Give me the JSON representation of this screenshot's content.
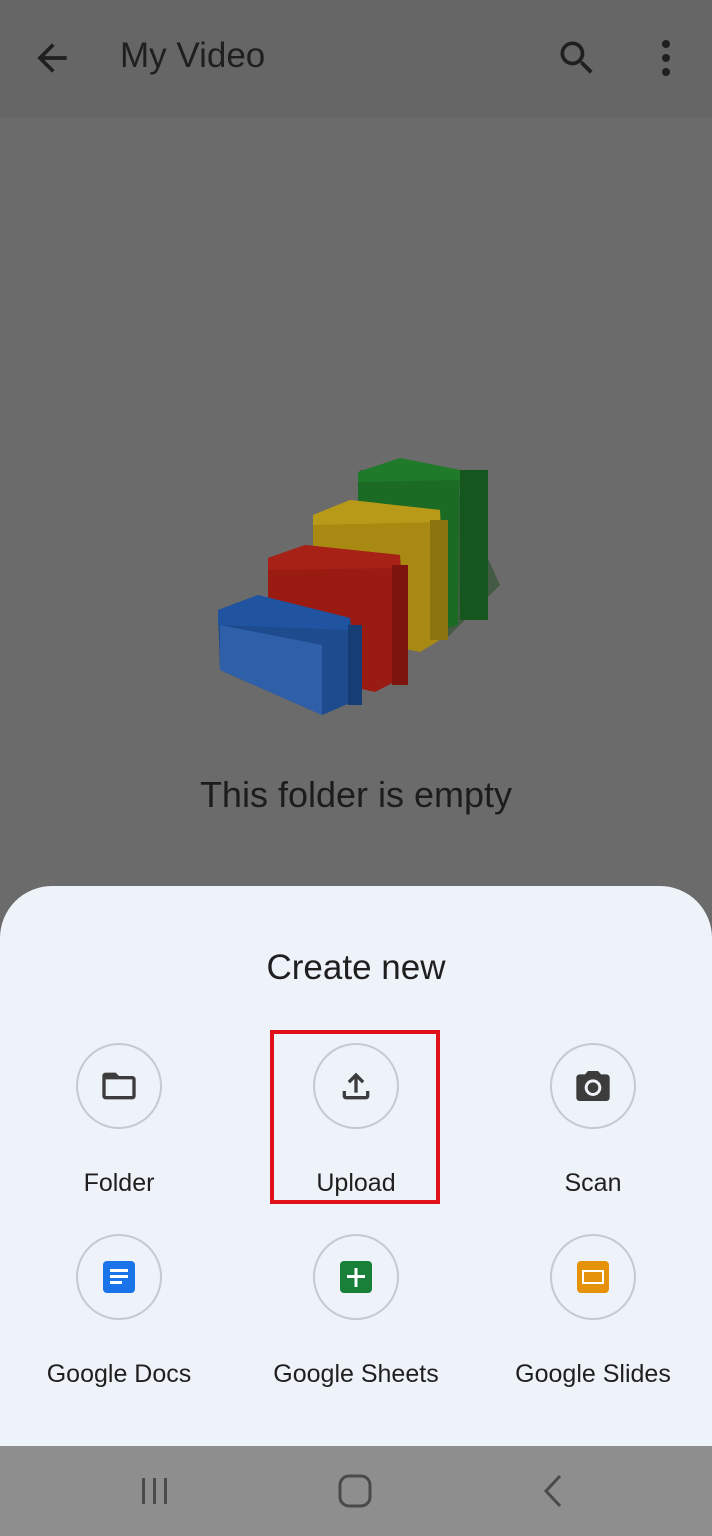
{
  "appbar": {
    "title": "My Video"
  },
  "main": {
    "empty_message": "This folder is empty"
  },
  "sheet": {
    "title": "Create new",
    "options": [
      {
        "label": "Folder",
        "icon": "folder-icon"
      },
      {
        "label": "Upload",
        "icon": "upload-icon"
      },
      {
        "label": "Scan",
        "icon": "camera-icon"
      },
      {
        "label": "Google Docs",
        "icon": "google-docs-icon"
      },
      {
        "label": "Google Sheets",
        "icon": "google-sheets-icon"
      },
      {
        "label": "Google Slides",
        "icon": "google-slides-icon"
      }
    ]
  },
  "colors": {
    "docs": "#1a73e8",
    "sheets": "#188038",
    "slides": "#e5910a",
    "highlight": "#e1111a"
  }
}
